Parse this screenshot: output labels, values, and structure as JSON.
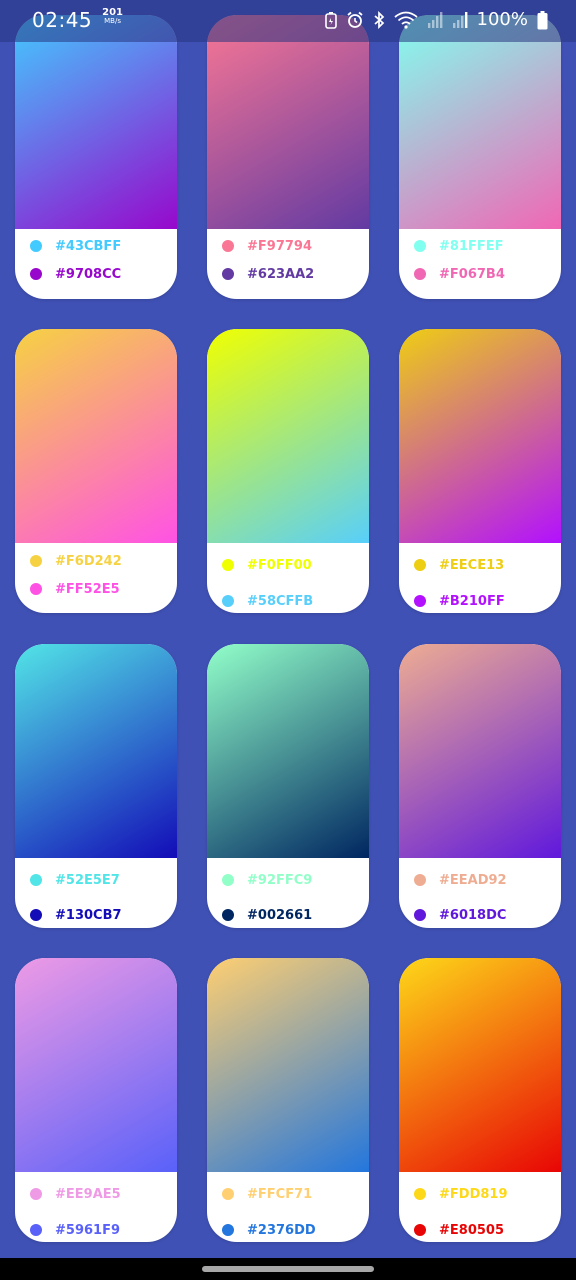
{
  "status_bar": {
    "time": "02:45",
    "net_speed_value": "201",
    "net_speed_unit": "MB/s",
    "battery_percent": "100%",
    "icons": [
      "battery-saver-icon",
      "alarm-icon",
      "bluetooth-icon",
      "wifi-icon",
      "signal-icon",
      "signal-icon-2",
      "battery-icon"
    ]
  },
  "cards": [
    {
      "color1": "#43CBFF",
      "color2": "#9708CC"
    },
    {
      "color1": "#F97794",
      "color2": "#623AA2"
    },
    {
      "color1": "#81FFEF",
      "color2": "#F067B4"
    },
    {
      "color1": "#F6D242",
      "color2": "#FF52E5"
    },
    {
      "color1": "#F0FF00",
      "color2": "#58CFFB"
    },
    {
      "color1": "#EECE13",
      "color2": "#B210FF"
    },
    {
      "color1": "#52E5E7",
      "color2": "#130CB7"
    },
    {
      "color1": "#92FFC9",
      "color2": "#002661"
    },
    {
      "color1": "#EEAD92",
      "color2": "#6018DC"
    },
    {
      "color1": "#EE9AE5",
      "color2": "#5961F9"
    },
    {
      "color1": "#FFCF71",
      "color2": "#2376DD"
    },
    {
      "color1": "#FDD819",
      "color2": "#E80505"
    }
  ]
}
